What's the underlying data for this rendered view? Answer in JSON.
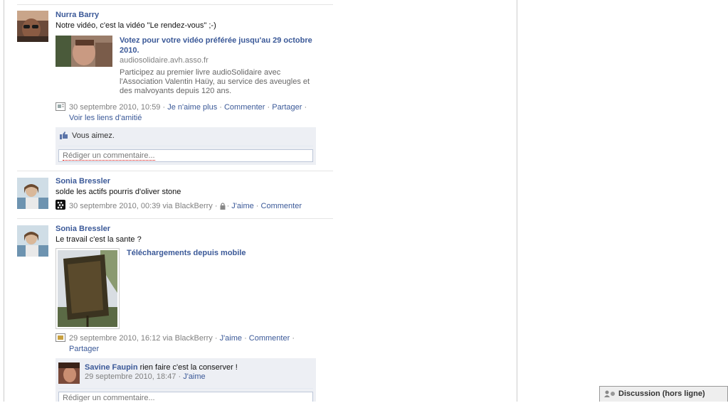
{
  "stories": [
    {
      "actor": "Nurra Barry",
      "message": "Notre vidéo, c'est la vidéo \"Le rendez-vous\" ;-)",
      "attachment": {
        "title": "Votez pour votre vidéo préférée jusqu'au 29 octobre 2010.",
        "caption": "audiosolidaire.avh.asso.fr",
        "description": "Participez au premier livre audioSolidaire avec l'Association Valentin Haüy, au service des aveugles et des malvoyants depuis 120 ans."
      },
      "timestamp": "30 septembre 2010, 10:59",
      "actions": [
        "Je n'aime plus",
        "Commenter",
        "Partager"
      ],
      "extra_action": "Voir les liens d'amitié",
      "likes_text": "Vous aimez.",
      "comment_placeholder": "Rédiger un commentaire..."
    },
    {
      "actor": "Sonia Bressler",
      "message": "solde les actifs pourris d'oliver stone",
      "timestamp": "30 septembre 2010, 00:39 via BlackBerry",
      "actions": [
        "J'aime",
        "Commenter"
      ]
    },
    {
      "actor": "Sonia Bressler",
      "message": "Le travail c'est la sante ?",
      "attachment": {
        "title": "Téléchargements depuis mobile"
      },
      "timestamp": "29 septembre 2010, 16:12 via BlackBerry",
      "actions": [
        "J'aime",
        "Commenter"
      ],
      "extra_action": "Partager",
      "comment": {
        "author": "Savine Faupin",
        "text": "rien faire c'est la conserver !",
        "timestamp": "29 septembre 2010, 18:47",
        "action": "J'aime"
      },
      "comment_placeholder": "Rédiger un commentaire..."
    }
  ],
  "chat": {
    "label": "Discussion (hors ligne)"
  },
  "colors": {
    "link": "#3b5998",
    "ufi_bg": "#edeff4"
  }
}
